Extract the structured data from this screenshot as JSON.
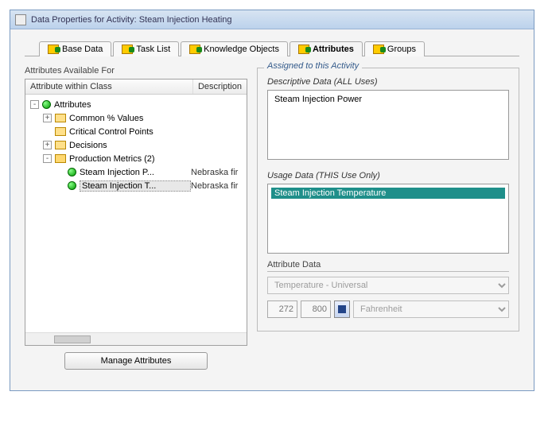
{
  "window": {
    "title": "Data Properties for Activity: Steam Injection Heating"
  },
  "tabs": [
    {
      "label": "Base Data"
    },
    {
      "label": "Task List"
    },
    {
      "label": "Knowledge Objects"
    },
    {
      "label": "Attributes"
    },
    {
      "label": "Groups"
    }
  ],
  "left": {
    "title": "Attributes Available For",
    "col_attr": "Attribute within Class",
    "col_desc": "Description",
    "root": "Attributes",
    "folders": {
      "common": "Common % Values",
      "ccp": "Critical Control Points",
      "decisions": "Decisions",
      "pm": "Production Metrics (2)"
    },
    "leaves": {
      "sip": {
        "label": "Steam Injection P...",
        "desc": "Nebraska fir"
      },
      "sit": {
        "label": "Steam Injection T...",
        "desc": "Nebraska fir"
      }
    },
    "manage_btn": "Manage Attributes"
  },
  "right": {
    "legend": "Assigned to this Activity",
    "desc_label": "Descriptive Data (ALL Uses)",
    "desc_items": [
      "Steam Injection Power"
    ],
    "usage_label": "Usage Data (THIS Use Only)",
    "usage_items": [
      "Steam Injection Temperature"
    ],
    "attr_data_label": "Attribute Data",
    "attr_type": "Temperature - Universal",
    "val_lo": "272",
    "val_hi": "800",
    "unit": "Fahrenheit"
  }
}
